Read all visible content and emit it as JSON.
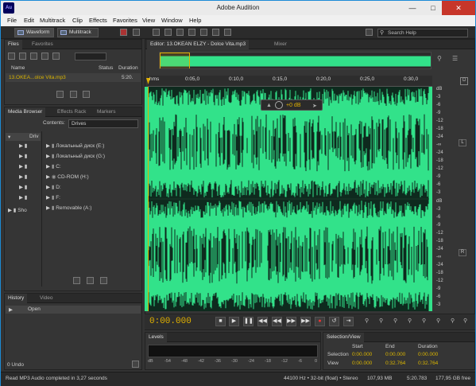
{
  "app": {
    "title": "Adobe Audition",
    "icon_label": "Au"
  },
  "menu": [
    "File",
    "Edit",
    "Multitrack",
    "Clip",
    "Effects",
    "Favorites",
    "View",
    "Window",
    "Help"
  ],
  "toolbar": {
    "waveform": "Waveform",
    "multitrack": "Multitrack",
    "search_placeholder": "Search Help"
  },
  "files_panel": {
    "tabs": [
      "Files",
      "Favorites"
    ],
    "col_name": "Name",
    "col_status": "Status",
    "col_duration": "Duration",
    "file_name": "13.OKEA...olce Vita.mp3",
    "file_duration": "5:20."
  },
  "media_browser": {
    "tabs": [
      "Media Browser",
      "Effects Rack",
      "Markers"
    ],
    "contents_label": "Contents:",
    "contents_value": "Drives",
    "tree_left": [
      "Driv",
      "Sho"
    ],
    "drives": [
      "Локальный диск (E:)",
      "Локальный диск (G:)",
      "C:",
      "CD-ROM (H:)",
      "D:",
      "F:",
      "Removable (A:)"
    ]
  },
  "history": {
    "tabs": [
      "History",
      "Video"
    ],
    "item": "Open",
    "undo": "0 Undo"
  },
  "editor": {
    "tab": "Editor: 13.OKEAN ELZY - Dolce Vita.mp3",
    "mixer": "Mixer",
    "ruler": [
      "hms",
      "0:05,0",
      "0:10,0",
      "0:15,0",
      "0:20,0",
      "0:25,0",
      "0:30,0"
    ],
    "gain": "+0 dB",
    "channel_l": "L",
    "channel_r": "R",
    "db_top": [
      "dB",
      "-3",
      "-6",
      "-9",
      "-12",
      "-18",
      "-24",
      "-∞",
      "-24",
      "-18",
      "-12",
      "-9",
      "-6",
      "-3"
    ],
    "db_bottom": [
      "dB",
      "-3",
      "-6",
      "-9",
      "-12",
      "-18",
      "-24",
      "-∞",
      "-24",
      "-18",
      "-12",
      "-9",
      "-6",
      "-3"
    ]
  },
  "transport": {
    "timecode": "0:00.000"
  },
  "levels": {
    "tab": "Levels",
    "scale": [
      "dB",
      "-54",
      "-48",
      "-42",
      "-36",
      "-30",
      "-24",
      "-18",
      "-12",
      "-6",
      "0"
    ]
  },
  "selection": {
    "tab": "Selection/View",
    "headers": [
      "Start",
      "End",
      "Duration"
    ],
    "selection_label": "Selection",
    "view_label": "View",
    "selection": [
      "0:00.000",
      "0:00.000",
      "0:00.000"
    ],
    "view": [
      "0:00.000",
      "0:32.764",
      "0:32.764"
    ]
  },
  "status": {
    "left": "Read MP3 Audio completed in 3,27 seconds",
    "format": "44100 Hz • 32-bit (float) • Stereo",
    "size": "107,93 MB",
    "duration": "5:20.783",
    "free": "177,95 GB free"
  },
  "colors": {
    "waveform": "#32e28a",
    "timecode": "#e1b100",
    "accent": "#1c8bd6"
  }
}
